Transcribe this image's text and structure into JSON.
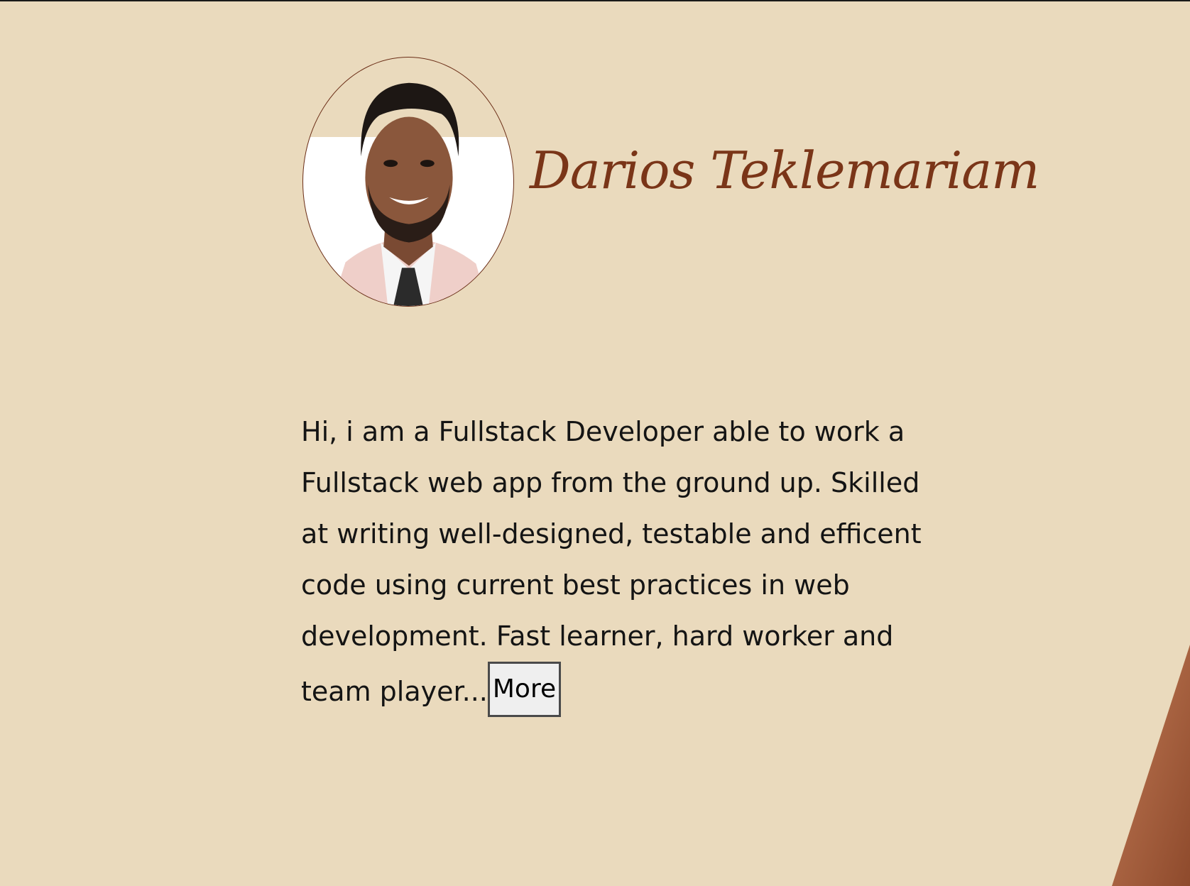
{
  "profile": {
    "name": "Darios Teklemariam",
    "avatar_alt": "profile-photo"
  },
  "bio": {
    "text": "Hi, i am a Fullstack Developer able to work a Fullstack web app from the ground up. Skilled at writing well-designed, testable and efficent code using current best practices in web development. Fast learner, hard worker and team player...",
    "more_label": "More"
  },
  "colors": {
    "background": "#eadabd",
    "name": "#7a3518",
    "accent": "#a0583a"
  }
}
